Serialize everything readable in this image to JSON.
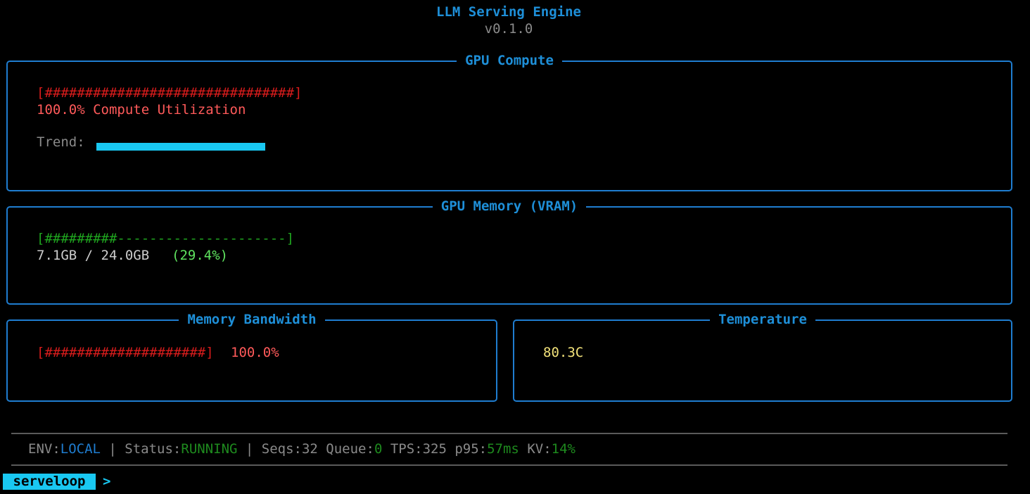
{
  "header": {
    "title": "LLM Serving Engine",
    "version": "v0.1.0"
  },
  "compute": {
    "title": "GPU Compute",
    "bar": "[###############################]",
    "utilization_text": "100.0% Compute Utilization",
    "trend_label": "Trend:",
    "utilization_fraction": 1.0
  },
  "memory": {
    "title": "GPU Memory (VRAM)",
    "bar": "[#########---------------------]",
    "usage": "7.1GB / 24.0GB",
    "percent": "(29.4%)"
  },
  "bandwidth": {
    "title": "Memory Bandwidth",
    "bar": "[####################]",
    "percent": "100.0%"
  },
  "temperature": {
    "title": "Temperature",
    "value": "80.3C"
  },
  "status": {
    "env_label": "ENV:",
    "env_value": "LOCAL",
    "sep1": " | ",
    "status_label": "Status:",
    "status_value": "RUNNING",
    "sep2": " | ",
    "seqs": "Seqs:32",
    "queue_label": " Queue:",
    "queue_value": "0",
    "tps": " TPS:325",
    "p95_label": " p95:",
    "p95_value": "57ms",
    "kv_label": " KV:",
    "kv_value": "14%"
  },
  "prompt": {
    "name": "serveloop",
    "caret": ">"
  },
  "colors": {
    "accent": "#1f7dd0",
    "critical": "#d81c1c",
    "ok": "#1fa51f",
    "trend": "#19c8f2",
    "warm": "#f2e27a"
  }
}
